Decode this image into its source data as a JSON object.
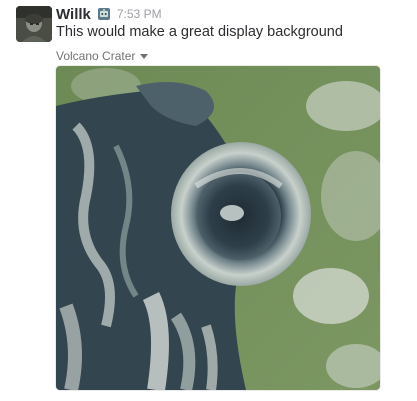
{
  "message": {
    "sender": "Willk",
    "status_icon": "robot-status-icon",
    "timestamp": "7:53 PM",
    "text": "This would make a great display background"
  },
  "attachment": {
    "title": "Volcano Crater",
    "expand_icon": "caret-down-icon",
    "image_subject": "aerial-volcano-crater"
  },
  "colors": {
    "sender": "#2c2d30",
    "timestamp": "#9e9ea6",
    "attachment_title": "#717274"
  }
}
